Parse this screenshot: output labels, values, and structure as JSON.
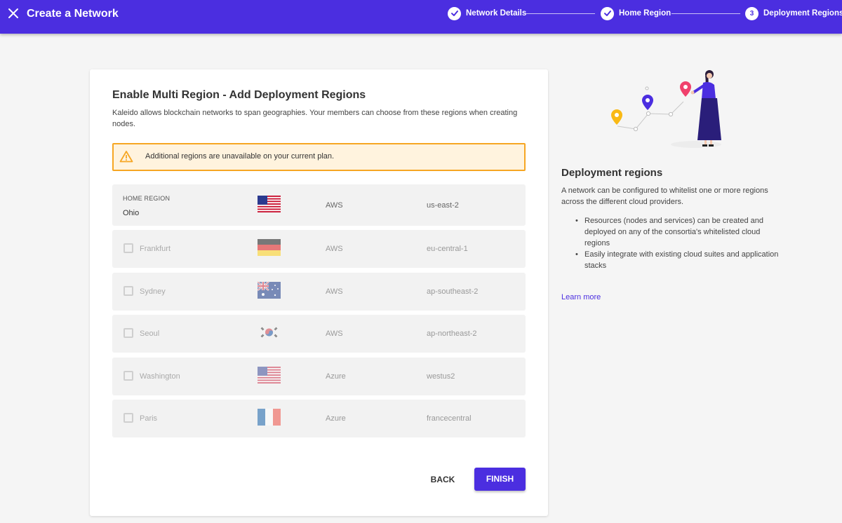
{
  "header": {
    "title": "Create a Network",
    "steps": [
      {
        "label": "Network Details",
        "state": "complete"
      },
      {
        "label": "Home Region",
        "state": "complete"
      },
      {
        "label": "Deployment Regions",
        "state": "active",
        "number": "3"
      }
    ]
  },
  "main": {
    "title": "Enable Multi Region - Add Deployment Regions",
    "description": "Kaleido allows blockchain networks to span geographies. Your members can choose from these regions when creating nodes.",
    "alert": "Additional regions are unavailable on your current plan.",
    "home_region": {
      "label": "HOME REGION",
      "city": "Ohio",
      "flag": "us-flag",
      "provider": "AWS",
      "code": "us-east-2"
    },
    "regions": [
      {
        "city": "Frankfurt",
        "flag": "germany-flag",
        "provider": "AWS",
        "code": "eu-central-1"
      },
      {
        "city": "Sydney",
        "flag": "australia-flag",
        "provider": "AWS",
        "code": "ap-southeast-2"
      },
      {
        "city": "Seoul",
        "flag": "south-korea-flag",
        "provider": "AWS",
        "code": "ap-northeast-2"
      },
      {
        "city": "Washington",
        "flag": "us-flag",
        "provider": "Azure",
        "code": "westus2"
      },
      {
        "city": "Paris",
        "flag": "france-flag",
        "provider": "Azure",
        "code": "francecentral"
      }
    ],
    "back_label": "BACK",
    "finish_label": "FINISH"
  },
  "side": {
    "title": "Deployment regions",
    "description": "A network can be configured to whitelist one or more regions across the different cloud providers.",
    "bullets": [
      "Resources (nodes and services) can be created and deployed on any of the consortia's whitelisted cloud regions",
      "Easily integrate with existing cloud suites and application stacks"
    ],
    "learn_more": "Learn more"
  },
  "colors": {
    "primary": "#4b2ee0",
    "warning_border": "#f6a623",
    "warning_bg": "#fff3de",
    "row_bg": "#f2f2f2"
  }
}
